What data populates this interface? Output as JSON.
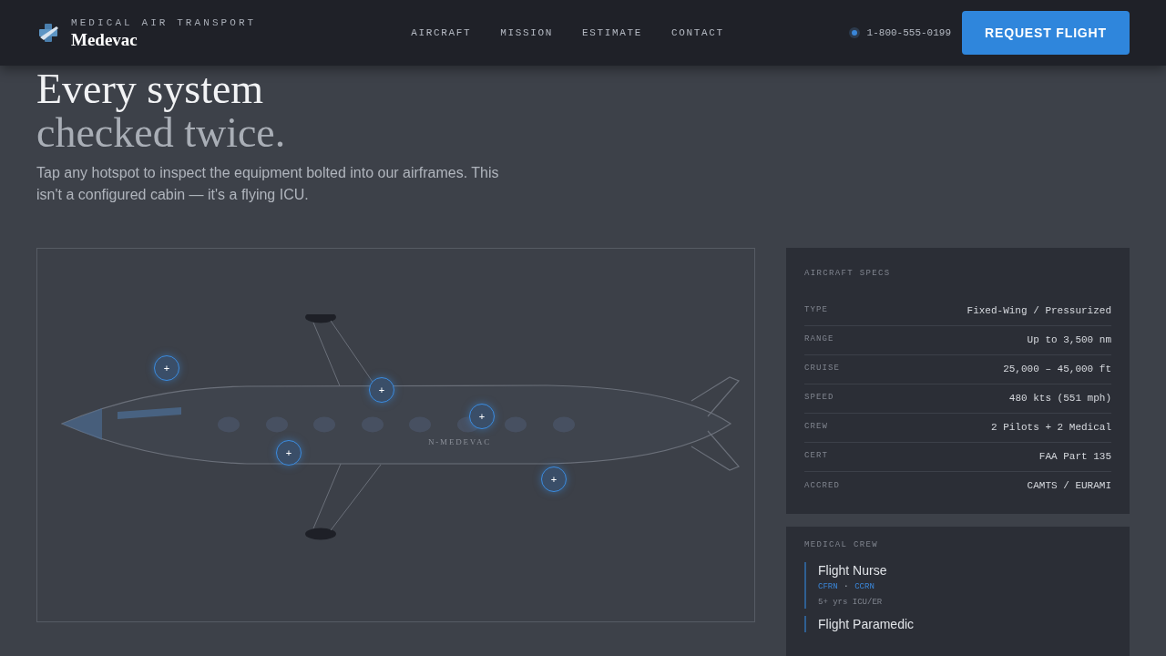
{
  "header": {
    "eyebrow": "MEDICAL AIR TRANSPORT",
    "brand": "Medevac",
    "nav": [
      "AIRCRAFT",
      "MISSION",
      "ESTIMATE",
      "CONTACT"
    ],
    "phone": "1-800-555-0199",
    "cta": "REQUEST FLIGHT"
  },
  "hero": {
    "title_line_1": "Every system",
    "title_line_2": "checked twice.",
    "intro": "Tap any hotspot to inspect the equipment bolted into our airframes. This isn't a configured cabin — it's a flying ICU."
  },
  "diagram": {
    "registration": "N-MEDEVAC",
    "hotspots": [
      "+",
      "+",
      "+",
      "+",
      "+"
    ]
  },
  "specs": {
    "title": "AIRCRAFT SPECS",
    "rows": [
      {
        "label": "TYPE",
        "value": "Fixed-Wing / Pressurized"
      },
      {
        "label": "RANGE",
        "value": "Up to 3,500 nm"
      },
      {
        "label": "CRUISE",
        "value": "25,000 – 45,000 ft"
      },
      {
        "label": "SPEED",
        "value": "480 kts (551 mph)"
      },
      {
        "label": "CREW",
        "value": "2 Pilots + 2 Medical"
      },
      {
        "label": "CERT",
        "value": "FAA Part 135"
      },
      {
        "label": "ACCRED",
        "value": "CAMTS / EURAMI"
      }
    ]
  },
  "crew": {
    "title": "MEDICAL CREW",
    "separator": "·",
    "members": [
      {
        "name": "Flight Nurse",
        "certs": [
          "CFRN",
          "CCRN"
        ],
        "experience": "5+ yrs ICU/ER"
      },
      {
        "name": "Flight Paramedic"
      }
    ]
  }
}
